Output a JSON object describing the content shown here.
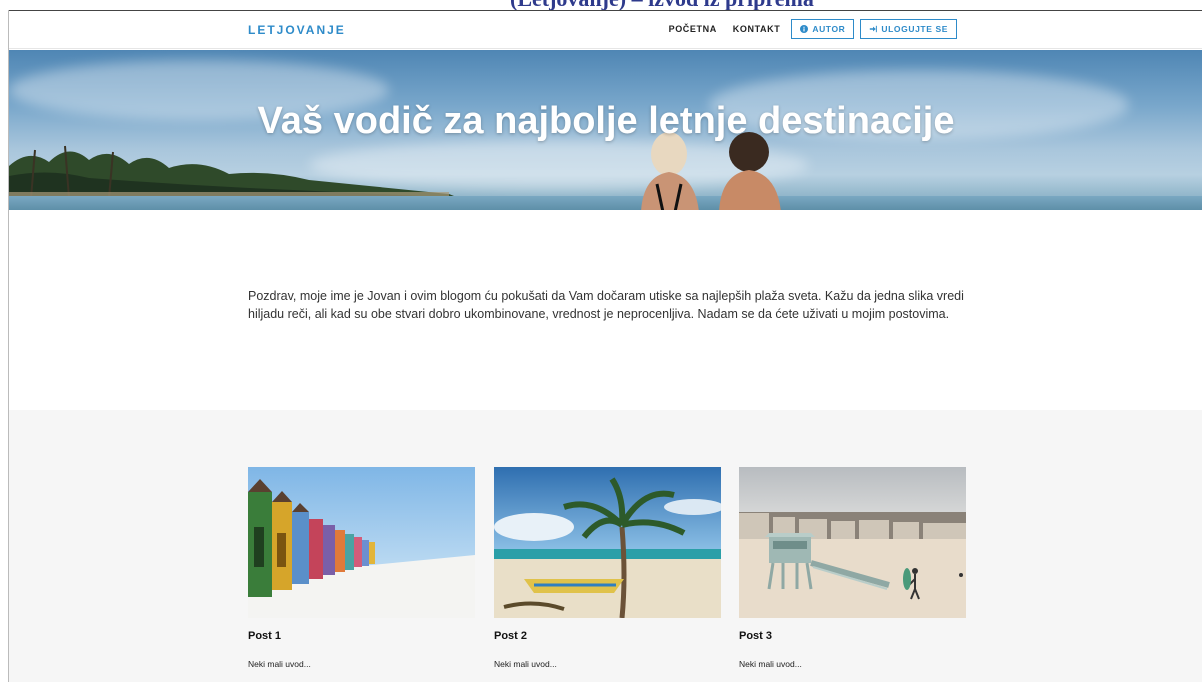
{
  "top_strip": {
    "text": "(Letjovanje) – izvod iz priprema"
  },
  "navbar": {
    "brand": "LETJOVANJE",
    "links": [
      {
        "label": "POČETNA"
      },
      {
        "label": "KONTAKT"
      }
    ],
    "author_button": {
      "label": "AUTOR",
      "icon": "info-circle-icon"
    },
    "login_button": {
      "label": "ULOGUJTE SE",
      "icon": "sign-in-icon"
    }
  },
  "hero": {
    "title": "Vaš vodič za najbolje letnje destinacije"
  },
  "intro": {
    "text": "Pozdrav, moje ime je Jovan i ovim blogom ću pokušati da Vam dočaram utiske sa najlepših plaža sveta. Kažu da jedna slika vredi hiljadu reči, ali kad su obe stvari dobro ukombinovane, vrednost je neprocenljiva. Nadam se da ćete uživati u mojim postovima."
  },
  "posts": [
    {
      "title": "Post 1",
      "intro": "Neki mali uvod...",
      "image": "beach-huts-image"
    },
    {
      "title": "Post 2",
      "intro": "Neki mali uvod...",
      "image": "palm-beach-image"
    },
    {
      "title": "Post 3",
      "intro": "Neki mali uvod...",
      "image": "lifeguard-tower-image"
    }
  ],
  "colors": {
    "accent": "#2e8bc9",
    "section_bg": "#f6f6f6",
    "text": "#333333"
  }
}
